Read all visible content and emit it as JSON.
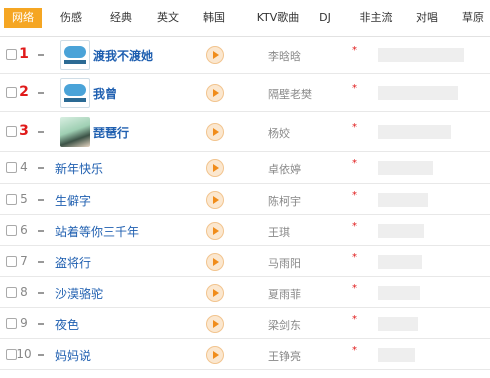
{
  "tabs": [
    {
      "label": "网络",
      "active": true
    },
    {
      "label": "伤感"
    },
    {
      "label": "经典"
    },
    {
      "label": "英文"
    },
    {
      "label": "韩国"
    },
    {
      "label": "KTV歌曲"
    },
    {
      "label": "DJ"
    },
    {
      "label": "非主流"
    },
    {
      "label": "对唱"
    },
    {
      "label": "草原"
    }
  ],
  "songs": [
    {
      "rank": "1",
      "title": "渡我不渡她",
      "artist": "李晗晗",
      "cover": "365-logo",
      "popularity": 0.78
    },
    {
      "rank": "2",
      "title": "我曾",
      "artist": "隔壁老樊",
      "cover": "365-logo",
      "popularity": 0.73
    },
    {
      "rank": "3",
      "title": "琵琶行",
      "artist": "杨姣",
      "cover": "portrait-photo",
      "popularity": 0.66
    },
    {
      "rank": "4",
      "title": "新年快乐",
      "artist": "卓依婷",
      "popularity": 0.5
    },
    {
      "rank": "5",
      "title": "生僻字",
      "artist": "陈柯宇",
      "popularity": 0.45
    },
    {
      "rank": "6",
      "title": "站着等你三千年",
      "artist": "王琪",
      "popularity": 0.42
    },
    {
      "rank": "7",
      "title": "盗将行",
      "artist": "马雨阳",
      "popularity": 0.4
    },
    {
      "rank": "8",
      "title": "沙漠骆驼",
      "artist": "夏雨菲",
      "popularity": 0.38
    },
    {
      "rank": "9",
      "title": "夜色",
      "artist": "梁剑东",
      "popularity": 0.36
    },
    {
      "rank": "10",
      "title": "妈妈说",
      "artist": "王铮亮",
      "popularity": 0.34
    }
  ],
  "colors": {
    "accent": "#f5a623",
    "rank_top": "#e01a1a",
    "link": "#1f5fb0",
    "star": "#e01a1a"
  },
  "star_glyph": "*"
}
